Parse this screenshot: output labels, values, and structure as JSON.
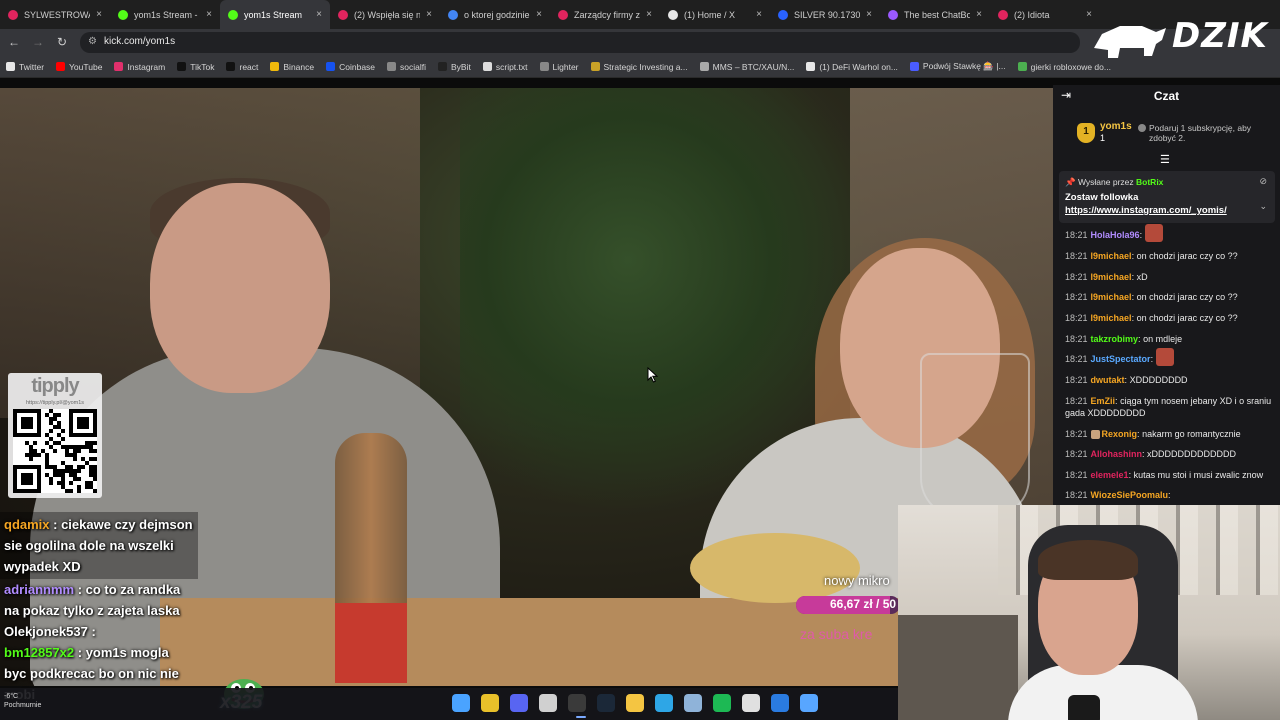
{
  "browser": {
    "tabs": [
      {
        "label": "SYLWESTROWA S",
        "color": "#e0245e",
        "active": false
      },
      {
        "label": "yom1s Stream - W",
        "color": "#53fc18",
        "active": false
      },
      {
        "label": "yom1s Stream",
        "color": "#53fc18",
        "active": true
      },
      {
        "label": "(2) Wspięła się na",
        "color": "#e0245e",
        "active": false
      },
      {
        "label": "o ktorej godzinie",
        "color": "#4285f4",
        "active": false
      },
      {
        "label": "Zarządcy firmy z C",
        "color": "#e0245e",
        "active": false
      },
      {
        "label": "(1) Home / X",
        "color": "#e7e7e7",
        "active": false
      },
      {
        "label": "SILVER 90.1730 ▼",
        "color": "#2962ff",
        "active": false
      },
      {
        "label": "The best ChatBo",
        "color": "#9b59ff",
        "active": false
      },
      {
        "label": "(2) Idiota",
        "color": "#e0245e",
        "active": false
      }
    ],
    "url": "kick.com/yom1s",
    "bookmarks": [
      {
        "label": "Twitter",
        "color": "#e7e7e7"
      },
      {
        "label": "YouTube",
        "color": "#ff0000"
      },
      {
        "label": "Instagram",
        "color": "#e1306c"
      },
      {
        "label": "TikTok",
        "color": "#111111"
      },
      {
        "label": "react",
        "color": "#111111"
      },
      {
        "label": "Binance",
        "color": "#f0b90b"
      },
      {
        "label": "Coinbase",
        "color": "#1652f0"
      },
      {
        "label": "socialfi",
        "color": "#888888"
      },
      {
        "label": "ByBit",
        "color": "#222222"
      },
      {
        "label": "script.txt",
        "color": "#dddddd"
      },
      {
        "label": "Lighter",
        "color": "#888888"
      },
      {
        "label": "Strategic Investing a...",
        "color": "#c9a227"
      },
      {
        "label": "MMS – BTC/XAU/N...",
        "color": "#aaaaaa"
      },
      {
        "label": "(1) DeFi Warhol on...",
        "color": "#e7e7e7"
      },
      {
        "label": "Podwój Stawkę 🎰 |...",
        "color": "#4a5cff"
      },
      {
        "label": "gierki robloxowe do...",
        "color": "#4caf50"
      }
    ]
  },
  "brand": {
    "text": "DZIK"
  },
  "tipply": {
    "title": "tipply",
    "url": "https://tipply.pl/@yom1s"
  },
  "overlay_chat": [
    {
      "user": "qdamix",
      "user_color": "#f5a623",
      "text": "ciekawe czy dejmson sie ogolilna dole na wszelki wypadek XD"
    },
    {
      "user": "adriannmm",
      "user_color": "#b18cff",
      "text": "co to za randka na pokaz tylko z zajeta laska"
    },
    {
      "user": "Olekjonek537",
      "user_color": "#ffffff",
      "text": ""
    },
    {
      "user": "bm12857x2",
      "user_color": "#53fc18",
      "text": "yom1s mogla byc podkrecac bo on nic nie zrobi"
    }
  ],
  "emote_multiplier": "x325",
  "donation": {
    "title": "nowy mikro",
    "amount_text": "66,67 zł / 50",
    "progress_fraction": 0.9,
    "subtitle": "za suba kre"
  },
  "chat": {
    "title": "Czat",
    "gifter": {
      "rank": "1",
      "user": "yom1s",
      "count": "1",
      "text": "Podaruj 1 subskrypcję, aby zdobyć 2."
    },
    "pinned": {
      "sent_by_prefix": "Wysłane przez",
      "bot_name": "BotRix",
      "message": "Zostaw followka",
      "link": "https://www.instagram.com/_yomis/"
    },
    "messages": [
      {
        "time": "18:21",
        "user": "HolaHola96",
        "user_color": "#b18cff",
        "text": "",
        "emote": true
      },
      {
        "time": "18:21",
        "user": "l9michael",
        "user_color": "#f5a623",
        "text": "on chodzi jarac czy co ??"
      },
      {
        "time": "18:21",
        "user": "l9michael",
        "user_color": "#f5a623",
        "text": "xD"
      },
      {
        "time": "18:21",
        "user": "l9michael",
        "user_color": "#f5a623",
        "text": "on chodzi jarac czy co ??"
      },
      {
        "time": "18:21",
        "user": "l9michael",
        "user_color": "#f5a623",
        "text": "on chodzi jarac czy co ??"
      },
      {
        "time": "18:21",
        "user": "takzrobimy",
        "user_color": "#53fc18",
        "text": "on mdleje"
      },
      {
        "time": "18:21",
        "user": "JustSpectator",
        "user_color": "#5aa9ff",
        "text": "",
        "emote": true
      },
      {
        "time": "18:21",
        "user": "dwutakt",
        "user_color": "#f5a623",
        "text": "XDDDDDDDD"
      },
      {
        "time": "18:21",
        "user": "EmZii",
        "user_color": "#f5a623",
        "text": "ciąga tym nosem jebany XD i o sraniu gada XDDDDDDDD"
      },
      {
        "time": "18:21",
        "user": "Rexonig",
        "user_color": "#f5a623",
        "text": "nakarm go romantycznie",
        "badge": true
      },
      {
        "time": "18:21",
        "user": "Allohashinn",
        "user_color": "#e0245e",
        "text": "xDDDDDDDDDDDDD"
      },
      {
        "time": "18:21",
        "user": "elemele1",
        "user_color": "#e0245e",
        "text": "kutas mu stoi i musi zwalic znow"
      },
      {
        "time": "18:21",
        "user": "WiozeSiePoomalu",
        "user_color": "#f5a623",
        "text": ""
      }
    ]
  },
  "taskbar": {
    "weather_temp": "-6°C",
    "weather_desc": "Pochmurnie",
    "icons": [
      {
        "name": "windows-start-icon",
        "color": "#4aa3ff"
      },
      {
        "name": "chrome-icon",
        "color": "#e8c02a"
      },
      {
        "name": "discord-icon",
        "color": "#5865f2"
      },
      {
        "name": "app-icon",
        "color": "#d0d0d0"
      },
      {
        "name": "obs-icon",
        "color": "#3a3a3a"
      },
      {
        "name": "steam-icon",
        "color": "#1b2838"
      },
      {
        "name": "folder-icon",
        "color": "#f4c542"
      },
      {
        "name": "sync-icon",
        "color": "#2ea6e6"
      },
      {
        "name": "tool-icon",
        "color": "#8fb3d9"
      },
      {
        "name": "spotify-icon",
        "color": "#1db954"
      },
      {
        "name": "app2-icon",
        "color": "#e0e0e0"
      },
      {
        "name": "xcode-icon",
        "color": "#2a7be0"
      },
      {
        "name": "notepad-icon",
        "color": "#58a6ff"
      }
    ]
  }
}
